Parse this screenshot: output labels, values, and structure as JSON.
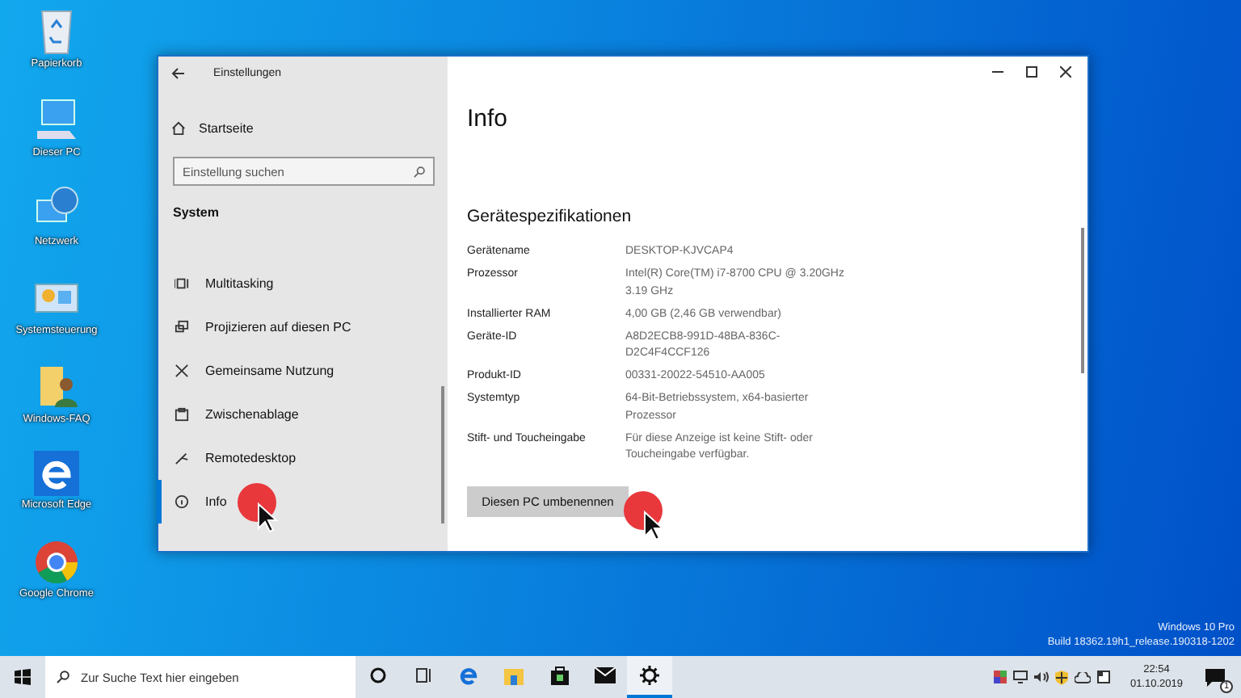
{
  "desktop_icons": [
    {
      "kind": "recycle-bin",
      "label": "Papierkorb"
    },
    {
      "kind": "computer",
      "label": "Dieser PC"
    },
    {
      "kind": "network",
      "label": "Netzwerk"
    },
    {
      "kind": "control-panel",
      "label": "Systemsteuerung"
    },
    {
      "kind": "user-folder",
      "label": "Windows-FAQ"
    },
    {
      "kind": "edge",
      "label": "Microsoft Edge"
    },
    {
      "kind": "chrome",
      "label": "Google Chrome"
    }
  ],
  "window": {
    "title": "Einstellungen",
    "sidebar": {
      "home": "Startseite",
      "search": {
        "placeholder": "Einstellung suchen"
      },
      "section": "System",
      "items": [
        {
          "kind": "multitasking",
          "label": "Multitasking",
          "selected": false
        },
        {
          "kind": "project",
          "label": "Projizieren auf diesen PC",
          "selected": false
        },
        {
          "kind": "share",
          "label": "Gemeinsame Nutzung",
          "selected": false
        },
        {
          "kind": "clipboard",
          "label": "Zwischenablage",
          "selected": false
        },
        {
          "kind": "remote",
          "label": "Remotedesktop",
          "selected": false
        },
        {
          "kind": "info",
          "label": "Info",
          "selected": true
        }
      ]
    },
    "content": {
      "title": "Info",
      "section": "Gerätespezifikationen",
      "specs": [
        {
          "label": "Gerätename",
          "value": [
            "DESKTOP-KJVCAP4"
          ]
        },
        {
          "label": "Prozessor",
          "value": [
            "Intel(R) Core(TM) i7-8700 CPU @ 3.20GHz",
            "3.19 GHz"
          ]
        },
        {
          "label": "Installierter RAM",
          "value": [
            "4,00 GB (2,46 GB verwendbar)"
          ]
        },
        {
          "label": "Geräte-ID",
          "value": [
            "A8D2ECB8-991D-48BA-836C-",
            "D2C4F4CCF126"
          ]
        },
        {
          "label": "Produkt-ID",
          "value": [
            "00331-20022-54510-AA005"
          ]
        },
        {
          "label": "Systemtyp",
          "value": [
            "64-Bit-Betriebssystem, x64-basierter",
            "Prozessor"
          ]
        },
        {
          "label": "Stift- und Toucheingabe",
          "value": [
            "Für diese Anzeige ist keine Stift- oder",
            "Toucheingabe verfügbar."
          ]
        }
      ],
      "button": "Diesen PC umbenennen"
    }
  },
  "os_watermark": [
    "Windows 10 Pro",
    "Build 18362.19h1_release.190318-1202"
  ],
  "taskbar": {
    "search": {
      "placeholder": "Zur Suche Text hier eingeben"
    },
    "apps": [
      {
        "kind": "cortana",
        "selected": false
      },
      {
        "kind": "taskview",
        "selected": false
      },
      {
        "kind": "edge",
        "selected": false
      },
      {
        "kind": "explorer",
        "selected": false
      },
      {
        "kind": "store",
        "selected": false
      },
      {
        "kind": "mail",
        "selected": false
      },
      {
        "kind": "settings",
        "selected": true
      }
    ],
    "time": "22:54",
    "date": "01.10.2019",
    "notifications": "1"
  }
}
